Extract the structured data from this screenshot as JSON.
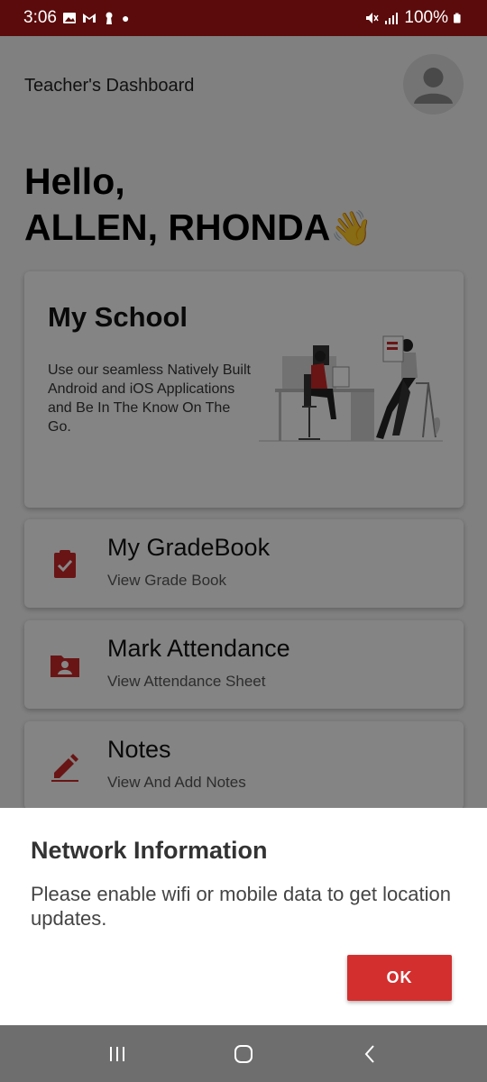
{
  "status_bar": {
    "time": "3:06",
    "battery": "100%"
  },
  "header": {
    "title": "Teacher's Dashboard"
  },
  "greeting": {
    "hello": "Hello,",
    "name": "ALLEN, RHONDA",
    "wave": "👋"
  },
  "school_card": {
    "title": "My School",
    "description": "Use our seamless Natively Built Android and iOS Applications and Be In The Know On The Go."
  },
  "menu": [
    {
      "title": "My GradeBook",
      "subtitle": "View Grade Book",
      "icon": "clipboard-check-icon"
    },
    {
      "title": "Mark Attendance",
      "subtitle": "View Attendance Sheet",
      "icon": "folder-person-icon"
    },
    {
      "title": "Notes",
      "subtitle": "View And Add Notes",
      "icon": "pencil-icon"
    }
  ],
  "dialog": {
    "title": "Network Information",
    "message": "Please enable wifi or mobile data to get location updates.",
    "ok_label": "OK"
  },
  "colors": {
    "accent": "#d32f2f",
    "status_bar": "#5b0b0b"
  }
}
